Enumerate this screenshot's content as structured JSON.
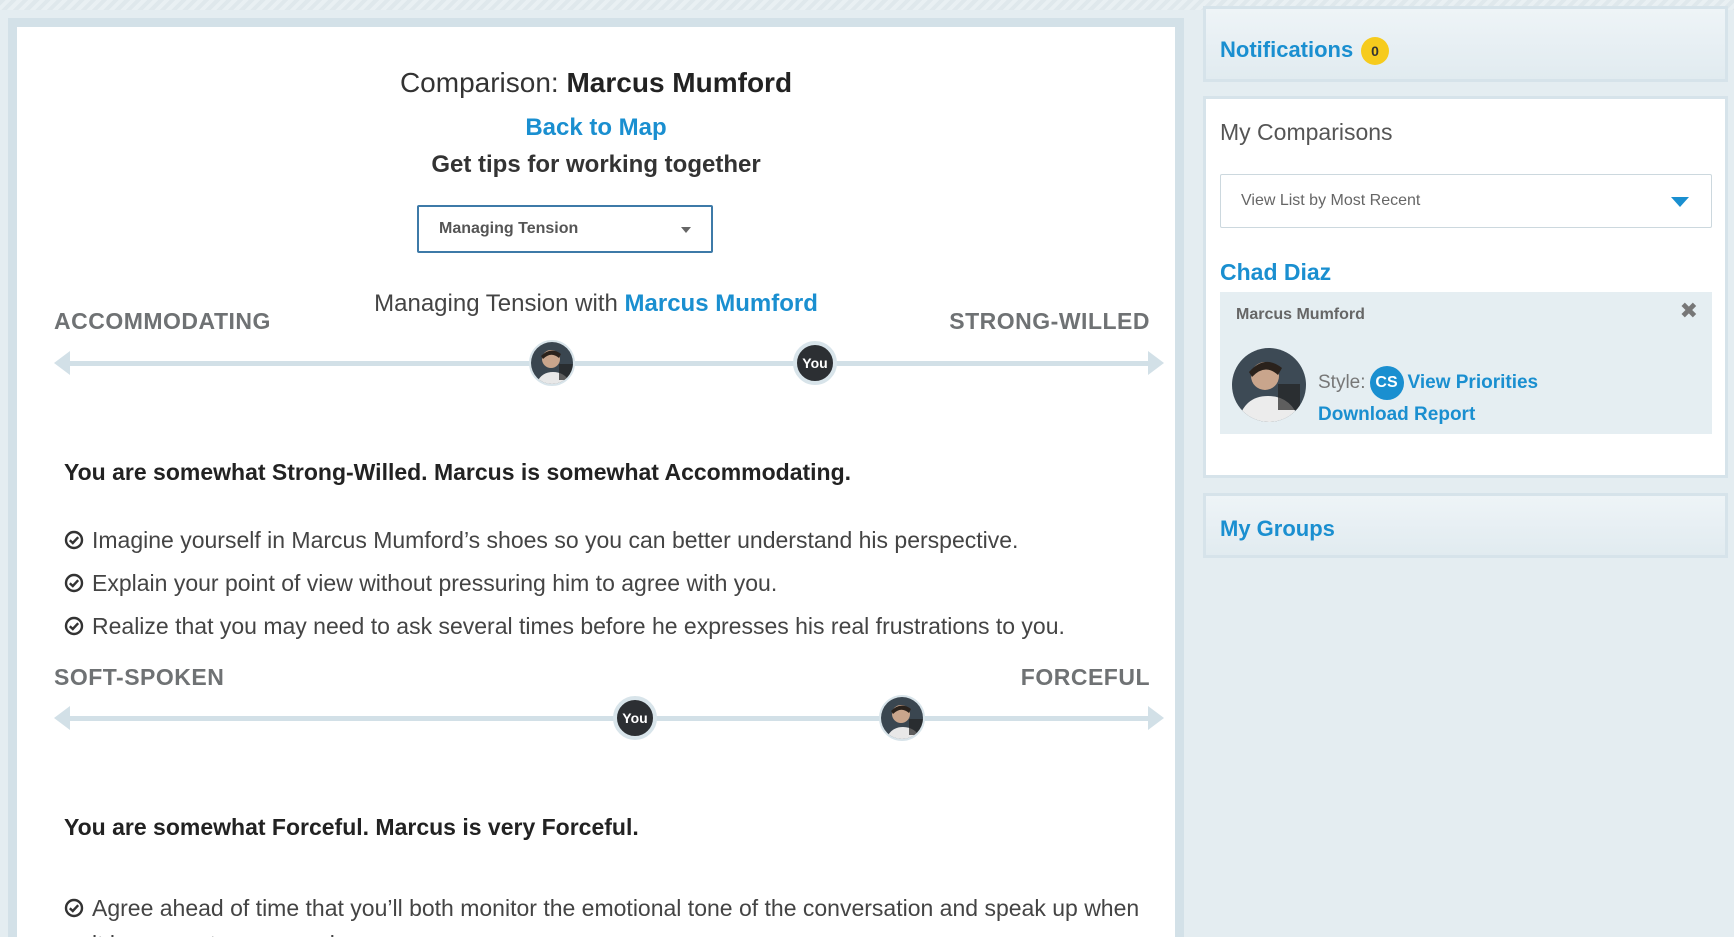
{
  "header": {
    "comparison_prefix": "Comparison: ",
    "comparison_name": "Marcus Mumford",
    "back_link": "Back to Map",
    "tips_heading": "Get tips for working together"
  },
  "topic_select": {
    "selected": "Managing Tension"
  },
  "subtitle": {
    "prefix": "Managing Tension with ",
    "name": "Marcus Mumford"
  },
  "scales": [
    {
      "left_label": "ACCOMMODATING",
      "right_label": "STRONG-WILLED",
      "you_marker": "You",
      "summary_you": "You are somewhat Strong-Willed.",
      "summary_them": "Marcus is somewhat Accommodating.",
      "tips": [
        "Imagine yourself in Marcus Mumford’s shoes so you can better understand his perspective.",
        "Explain your point of view without pressuring him to agree with you.",
        "Realize that you may need to ask several times before he expresses his real frustrations to you."
      ]
    },
    {
      "left_label": "SOFT-SPOKEN",
      "right_label": "FORCEFUL",
      "you_marker": "You",
      "summary_you": "You are somewhat Forceful.",
      "summary_them": "Marcus is very Forceful.",
      "tips": [
        "Agree ahead of time that you’ll both monitor the emotional tone of the conversation and speak up when it becomes too aggressive."
      ]
    }
  ],
  "sidebar": {
    "notifications": {
      "label": "Notifications",
      "count": "0",
      "badge_color": "#f6cb1d"
    },
    "comparisons": {
      "heading": "My Comparisons",
      "view_select": "View List by Most Recent",
      "group_name": "Chad Diaz",
      "card": {
        "person": "Marcus Mumford",
        "close": "✖",
        "style_label": "Style:",
        "style_badge": "CS",
        "view_priorities": "View Priorities",
        "download_report": "Download Report"
      }
    },
    "groups": {
      "label": "My Groups"
    }
  },
  "colors": {
    "accent": "#1a8fd0",
    "track": "#d2e0e7",
    "you_marker": "#2c2f33"
  }
}
